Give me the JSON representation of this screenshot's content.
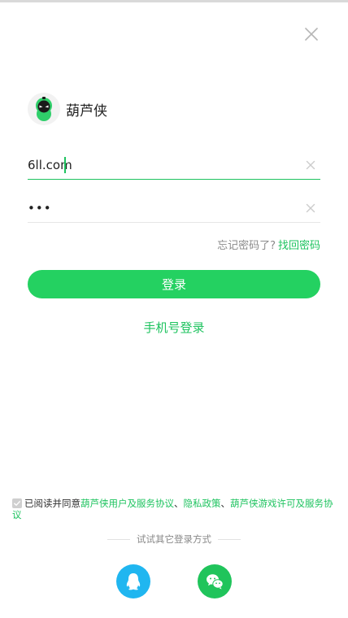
{
  "app": {
    "name": "葫芦侠",
    "logo_icon": "huluxia-logo-icon"
  },
  "close_icon": "close-icon",
  "username_field": {
    "value": "6ll.com",
    "clear_icon": "clear-icon"
  },
  "password_field": {
    "value": "•••",
    "clear_icon": "clear-icon"
  },
  "forgot": {
    "question": "忘记密码了?",
    "link": "找回密码"
  },
  "login_button": "登录",
  "phone_login_link": "手机号登录",
  "agreement": {
    "prefix": "已阅读并同意",
    "link1": "葫芦侠用户及服务协议",
    "sep1": "、",
    "link2": "隐私政策",
    "sep2": "、",
    "link3": "葫芦侠游戏许可及服务协议",
    "checked": true
  },
  "other_login_label": "试试其它登录方式",
  "social_logins": [
    {
      "name": "qq",
      "icon": "qq-icon",
      "color": "#20b6f0"
    },
    {
      "name": "wechat",
      "icon": "wechat-icon",
      "color": "#20c45b"
    }
  ],
  "colors": {
    "accent": "#1ec35f",
    "button": "#24d161"
  }
}
